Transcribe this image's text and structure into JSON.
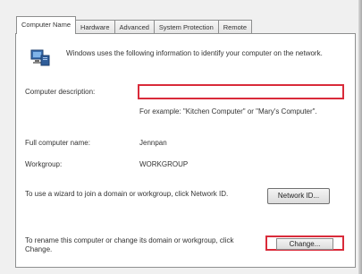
{
  "tabs": [
    {
      "label": "Computer Name",
      "active": true
    },
    {
      "label": "Hardware",
      "active": false
    },
    {
      "label": "Advanced",
      "active": false
    },
    {
      "label": "System Protection",
      "active": false
    },
    {
      "label": "Remote",
      "active": false
    }
  ],
  "intro": "Windows uses the following information to identify your computer on the network.",
  "description": {
    "label": "Computer description:",
    "value": "",
    "example": "For example: \"Kitchen Computer\" or \"Mary's Computer\"."
  },
  "full_name": {
    "label": "Full computer name:",
    "value": "Jennpan"
  },
  "workgroup": {
    "label": "Workgroup:",
    "value": "WORKGROUP"
  },
  "network": {
    "text": "To use a wizard to join a domain or workgroup, click Network ID.",
    "button": "Network ID..."
  },
  "rename": {
    "text": "To rename this computer or change its domain or workgroup, click Change.",
    "button": "Change..."
  },
  "colors": {
    "highlight": "#d92b3a",
    "panel_bg": "#ffffff",
    "window_bg": "#f0f0f0"
  },
  "icons": {
    "computer": "computer-icon"
  }
}
